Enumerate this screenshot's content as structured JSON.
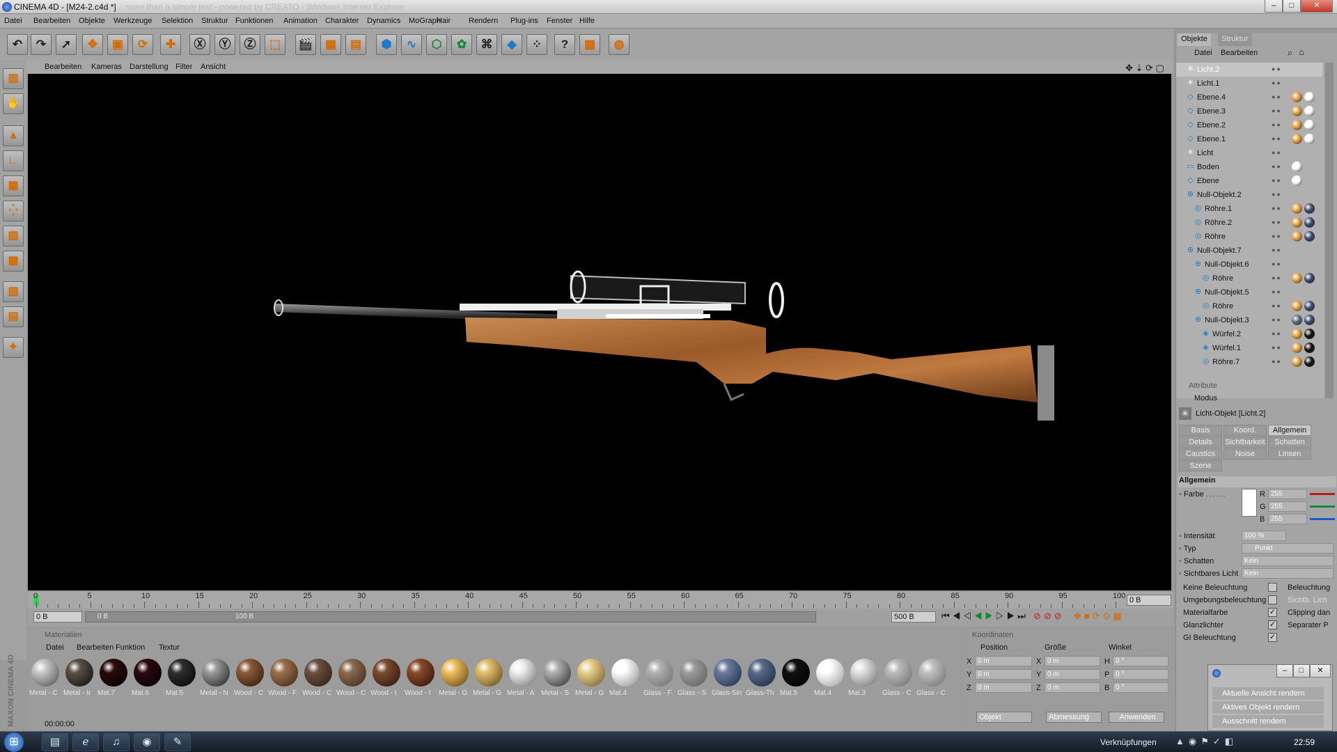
{
  "window": {
    "title": "CINEMA 4D - [M24-2.c4d *]",
    "ghost_title": "more than a simple text - powered by CREATO - Windows Internet Explorer",
    "min_label": "–",
    "max_label": "□",
    "close_label": "✕"
  },
  "menu": [
    "Datei",
    "Bearbeiten",
    "Objekte",
    "Werkzeuge",
    "Selektion",
    "Struktur",
    "Funktionen",
    "Animation",
    "Charakter",
    "Dynamics",
    "MoGraph",
    "Hair",
    "Rendern",
    "Plug-ins",
    "Fenster",
    "Hilfe"
  ],
  "toolbar_icons": [
    "undo-icon",
    "redo-icon",
    "select-pointer-icon",
    "move-icon",
    "scale-icon",
    "rotate-icon",
    "move-live-icon",
    "x-axis-icon",
    "y-axis-icon",
    "z-axis-icon",
    "world-coordinates-icon",
    "render-view-icon",
    "render-picture-viewer-icon",
    "render-settings-icon",
    "cube-primitive-icon",
    "spline-icon",
    "nurbs-icon",
    "array-icon",
    "deformer-icon",
    "camera-icon",
    "particle-icon",
    "help-icon",
    "scene-table-icon",
    "globe-icon"
  ],
  "left_tools": [
    "layout-icon",
    "sculpt-icon",
    "model-mode-icon",
    "axis-mode-icon",
    "texture-mode-icon",
    "points-mode-icon",
    "edges-mode-icon",
    "polygons-mode-icon",
    "checker-icon",
    "uvw-icon",
    "paint-icon"
  ],
  "viewport_menu": [
    "Bearbeiten",
    "Kameras",
    "Darstellung",
    "Filter",
    "Ansicht"
  ],
  "timeline": {
    "ticks": [
      "0",
      "5",
      "10",
      "15",
      "20",
      "25",
      "30",
      "35",
      "40",
      "45",
      "50",
      "55",
      "60",
      "65",
      "70",
      "75",
      "80",
      "85",
      "90",
      "95",
      "100"
    ],
    "current_frame": "0 B",
    "start_field": "0 B",
    "range_start": "0 B",
    "range_end": "100 B",
    "end_field": "500 B"
  },
  "materials": {
    "header": "Materialien",
    "menu": [
      "Datei",
      "Bearbeiten",
      "Funktion",
      "Textur"
    ],
    "items": [
      {
        "label": "Metal - C",
        "color": "#c8c8c8",
        "shade": "#4a4a4a"
      },
      {
        "label": "Metal - Ir",
        "color": "#5a5048",
        "shade": "#0a0a0a"
      },
      {
        "label": "Mat.7",
        "color": "#2a0a0a",
        "shade": "#000000"
      },
      {
        "label": "Mat.6",
        "color": "#2a0810",
        "shade": "#000000"
      },
      {
        "label": "Mat.5",
        "color": "#303030",
        "shade": "#000000"
      },
      {
        "label": "Metal - N",
        "color": "#9a9a9a",
        "shade": "#1a1a1a"
      },
      {
        "label": "Wood - C",
        "color": "#8a5a3a",
        "shade": "#2a1608"
      },
      {
        "label": "Wood - F",
        "color": "#9a7050",
        "shade": "#3a2410"
      },
      {
        "label": "Wood - C",
        "color": "#6a5040",
        "shade": "#2a1a0e"
      },
      {
        "label": "Wood - C",
        "color": "#8a6a50",
        "shade": "#3a2818"
      },
      {
        "label": "Wood - I",
        "color": "#7a4a30",
        "shade": "#2a1408"
      },
      {
        "label": "Wood - I",
        "color": "#8a4a2a",
        "shade": "#2a1006"
      },
      {
        "label": "Metal - G",
        "color": "#f0c060",
        "shade": "#5a3a08"
      },
      {
        "label": "Metal - G",
        "color": "#e0c070",
        "shade": "#5a4010"
      },
      {
        "label": "Metal - A",
        "color": "#f0f0f0",
        "shade": "#6a6a6a"
      },
      {
        "label": "Metal - S",
        "color": "#b0b0b0",
        "shade": "#2a2a2a"
      },
      {
        "label": "Metal - G",
        "color": "#e8d090",
        "shade": "#6a5420"
      },
      {
        "label": "Mat.4",
        "color": "#ffffff",
        "shade": "#8a8a8a"
      },
      {
        "label": "Glass - F",
        "color": "#b0b0b0",
        "shade": "#6a6a6a"
      },
      {
        "label": "Glass - S",
        "color": "#9a9a9a",
        "shade": "#5a5a5a"
      },
      {
        "label": "Glass-Sin",
        "color": "#6a7a9a",
        "shade": "#1a2a4a"
      },
      {
        "label": "Glass-Th",
        "color": "#5a6a8a",
        "shade": "#1a2440"
      },
      {
        "label": "Mat.5",
        "color": "#101010",
        "shade": "#000000"
      },
      {
        "label": "Mat.4",
        "color": "#ffffff",
        "shade": "#9a9a9a"
      },
      {
        "label": "Mat.3",
        "color": "#e0e0e0",
        "shade": "#6a6a6a"
      },
      {
        "label": "Glass - C",
        "color": "#bababa",
        "shade": "#6a6a6a"
      },
      {
        "label": "Glass - C",
        "color": "#c0c0c0",
        "shade": "#6a6a6a"
      }
    ]
  },
  "coordinates": {
    "header": "Koordinaten",
    "col_position": "Position",
    "col_size": "Größe",
    "col_angle": "Winkel",
    "rows": [
      {
        "axis": "X",
        "pos": "0 m",
        "size_axis": "X",
        "size": "0 m",
        "ang_axis": "H",
        "ang": "0 °"
      },
      {
        "axis": "Y",
        "pos": "0 m",
        "size_axis": "Y",
        "size": "0 m",
        "ang_axis": "P",
        "ang": "0 °"
      },
      {
        "axis": "Z",
        "pos": "0 m",
        "size_axis": "Z",
        "size": "0 m",
        "ang_axis": "B",
        "ang": "0 °"
      }
    ],
    "mode_select": "Objekt",
    "size_select": "Abmessung",
    "apply_button": "Anwenden"
  },
  "objects_panel": {
    "tabs": [
      "Objekte",
      "Struktur"
    ],
    "menu": [
      "Datei",
      "Bearbeiten"
    ],
    "items": [
      {
        "name": "Licht.2",
        "depth": 0,
        "icon": "light-icon",
        "selected": true,
        "tags": []
      },
      {
        "name": "Licht.1",
        "depth": 0,
        "icon": "light-icon",
        "selected": false,
        "tags": []
      },
      {
        "name": "Ebene.4",
        "depth": 0,
        "icon": "plane-icon",
        "selected": false,
        "tags": [
          "#e8a040",
          "#ffffff"
        ]
      },
      {
        "name": "Ebene.3",
        "depth": 0,
        "icon": "plane-icon",
        "selected": false,
        "tags": [
          "#e8a040",
          "#ffffff"
        ]
      },
      {
        "name": "Ebene.2",
        "depth": 0,
        "icon": "plane-icon",
        "selected": false,
        "tags": [
          "#e8a040",
          "#ffffff"
        ]
      },
      {
        "name": "Ebene.1",
        "depth": 0,
        "icon": "plane-icon",
        "selected": false,
        "tags": [
          "#e8a040",
          "#ffffff"
        ]
      },
      {
        "name": "Licht",
        "depth": 0,
        "icon": "light-icon",
        "selected": false,
        "tags": []
      },
      {
        "name": "Boden",
        "depth": 0,
        "icon": "floor-icon",
        "selected": false,
        "tags": [
          "#ffffff"
        ]
      },
      {
        "name": "Ebene",
        "depth": 0,
        "icon": "plane-icon",
        "selected": false,
        "tags": [
          "#ffffff"
        ]
      },
      {
        "name": "Null-Objekt.2",
        "depth": 0,
        "icon": "null-icon",
        "selected": false,
        "tags": []
      },
      {
        "name": "Röhre.1",
        "depth": 1,
        "icon": "tube-icon",
        "selected": false,
        "tags": [
          "#e8a040",
          "#3a4a6a"
        ]
      },
      {
        "name": "Röhre.2",
        "depth": 1,
        "icon": "tube-icon",
        "selected": false,
        "tags": [
          "#e8a040",
          "#3a4a6a"
        ]
      },
      {
        "name": "Röhre",
        "depth": 1,
        "icon": "tube-icon",
        "selected": false,
        "tags": [
          "#e8a040",
          "#3a4a6a"
        ]
      },
      {
        "name": "Null-Objekt.7",
        "depth": 0,
        "icon": "null-icon",
        "selected": false,
        "tags": []
      },
      {
        "name": "Null-Objekt.6",
        "depth": 1,
        "icon": "null-icon",
        "selected": false,
        "tags": []
      },
      {
        "name": "Röhre",
        "depth": 2,
        "icon": "tube-icon",
        "selected": false,
        "tags": [
          "#e8a040",
          "#3a4a6a"
        ]
      },
      {
        "name": "Null-Objekt.5",
        "depth": 1,
        "icon": "null-icon",
        "selected": false,
        "tags": []
      },
      {
        "name": "Röhre",
        "depth": 2,
        "icon": "tube-icon",
        "selected": false,
        "tags": [
          "#e8a040",
          "#3a4a6a"
        ]
      },
      {
        "name": "Null-Objekt.3",
        "depth": 1,
        "icon": "null-icon",
        "selected": false,
        "tags": [
          "#5a6a7a",
          "#3a4a6a"
        ]
      },
      {
        "name": "Würfel.2",
        "depth": 2,
        "icon": "cube-icon",
        "selected": false,
        "tags": [
          "#e8a040",
          "#101010"
        ]
      },
      {
        "name": "Würfel.1",
        "depth": 2,
        "icon": "cube-icon",
        "selected": false,
        "tags": [
          "#e8a040",
          "#101010"
        ]
      },
      {
        "name": "Röhre.7",
        "depth": 2,
        "icon": "tube-icon",
        "selected": false,
        "tags": [
          "#e8a040",
          "#101010"
        ]
      }
    ]
  },
  "attributes": {
    "header": "Attribute",
    "mode_label": "Modus",
    "object_title": "Licht-Objekt [Licht.2]",
    "tabs": [
      {
        "label": "Basis",
        "active": false
      },
      {
        "label": "Koord.",
        "active": false
      },
      {
        "label": "Allgemein",
        "active": true
      },
      {
        "label": "Details",
        "active": false
      },
      {
        "label": "Sichtbarkeit",
        "active": false
      },
      {
        "label": "Schatten",
        "active": false
      },
      {
        "label": "Caustics",
        "active": false
      },
      {
        "label": "Noise",
        "active": false
      },
      {
        "label": "Linsen",
        "active": false
      },
      {
        "label": "Szene",
        "active": false
      }
    ],
    "section": "Allgemein",
    "color_label": "Farbe",
    "color_dots": ". . . . . .",
    "r_label": "R",
    "r_value": "255",
    "g_label": "G",
    "g_value": "255",
    "b_label": "B",
    "b_value": "255",
    "intensity_label": "Intensität",
    "intensity_value": "100 %",
    "type_label": "Typ",
    "type_value": "Punkt",
    "shadow_label": "Schatten",
    "shadow_value": "Kein",
    "visible_light_label": "Sichtbares Licht",
    "visible_light_value": "Kein",
    "checks": [
      {
        "label": "Keine Beleuchtung",
        "checked": false,
        "side": "Beleuchtung"
      },
      {
        "label": "Umgebungsbeleuchtung",
        "checked": false,
        "side": "Sichtb. Lich"
      },
      {
        "label": "Materialfarbe",
        "checked": true,
        "side": "Clipping dan"
      },
      {
        "label": "Glanzlichter",
        "checked": true,
        "side": "Separater P"
      },
      {
        "label": "GI Beleuchtung",
        "checked": true,
        "side": ""
      }
    ]
  },
  "render_menu": {
    "items": [
      "Aktuelle Ansicht rendern",
      "Aktives Objekt rendern",
      "Ausschnitt rendern"
    ]
  },
  "status": {
    "time": "00:00:00",
    "brand": "MAXON CINEMA 4D"
  },
  "taskbar": {
    "links_label": "Verknüpfungen",
    "clock": "22:59",
    "apps": [
      "explorer-icon",
      "ie-icon",
      "media-icon",
      "cinema4d-icon",
      "tool-icon"
    ]
  },
  "colors": {
    "accent_orange": "#d46a00",
    "wood": "#b0703a",
    "viewport_bg": "#000000"
  }
}
